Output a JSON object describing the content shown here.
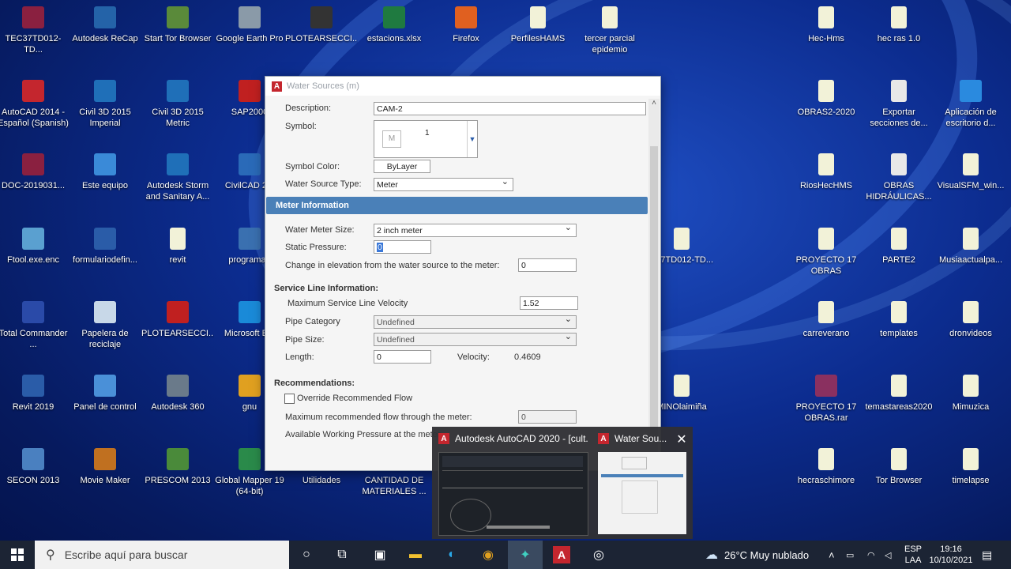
{
  "desktop_icons": [
    {
      "label": "TEC37TD012-TD...",
      "icon": "bitmap-icon",
      "color": "#8a2040"
    },
    {
      "label": "Autodesk ReCap",
      "icon": "recap-icon",
      "color": "#2463a8"
    },
    {
      "label": "Start Tor Browser",
      "icon": "tor-icon",
      "color": "#5a8a3a"
    },
    {
      "label": "Google Earth Pro",
      "icon": "earth-icon",
      "color": "#8a9aa8"
    },
    {
      "label": "PLOTEARSECCI...",
      "icon": "printer-icon",
      "color": "#333333"
    },
    {
      "label": "estacions.xlsx",
      "icon": "excel-icon",
      "color": "#1f7a40"
    },
    {
      "label": "Firefox",
      "icon": "firefox-icon",
      "color": "#e06020"
    },
    {
      "label": "PerfilesHAMS",
      "icon": "file-icon",
      "color": "#f2f2d8"
    },
    {
      "label": "tercer parcial epidemio",
      "icon": "pdf-file-icon",
      "color": "#f2f2d8"
    },
    {
      "label": "Hec-Hms",
      "icon": "file-icon",
      "color": "#f2f2d8"
    },
    {
      "label": "hec ras 1.0",
      "icon": "folder-file-icon",
      "color": "#f2f2d8"
    },
    {
      "label": "AutoCAD 2014 - Español (Spanish)",
      "icon": "autocad-icon",
      "color": "#c4262e"
    },
    {
      "label": "Civil 3D 2015 Imperial",
      "icon": "civil3d-icon",
      "color": "#1f6fb8"
    },
    {
      "label": "Civil 3D 2015 Metric",
      "icon": "civil3d-icon",
      "color": "#1f6fb8"
    },
    {
      "label": "SAP2000",
      "icon": "sap-icon",
      "color": "#c02020"
    },
    {
      "label": "OBRAS2-2020",
      "icon": "file-icon",
      "color": "#f2f2d8"
    },
    {
      "label": "Exportar secciones de...",
      "icon": "document-icon",
      "color": "#e8e8e8"
    },
    {
      "label": "Aplicación de escritorio d...",
      "icon": "app-icon",
      "color": "#2a8adf"
    },
    {
      "label": "DOC-2019031...",
      "icon": "bitmap-icon",
      "color": "#8a2040"
    },
    {
      "label": "Este equipo",
      "icon": "computer-icon",
      "color": "#3a8ad8"
    },
    {
      "label": "Autodesk Storm and Sanitary A...",
      "icon": "storm-icon",
      "color": "#1f6fb8"
    },
    {
      "label": "CivilCAD 2...",
      "icon": "civilcad-icon",
      "color": "#2a6ab8"
    },
    {
      "label": "RiosHecHMS",
      "icon": "file-icon",
      "color": "#f2f2d8"
    },
    {
      "label": "OBRAS HIDRÁULICAS...",
      "icon": "document-icon",
      "color": "#e8e8e8"
    },
    {
      "label": "VisualSFM_win...",
      "icon": "file-icon",
      "color": "#f2f2d8"
    },
    {
      "label": "Ftool.exe.enc",
      "icon": "ftool-icon",
      "color": "#5aa0d0"
    },
    {
      "label": "formulariodefin...",
      "icon": "word-icon",
      "color": "#2a5ca8"
    },
    {
      "label": "revit",
      "icon": "file-icon",
      "color": "#f2f2d8"
    },
    {
      "label": "programa1",
      "icon": "python-icon",
      "color": "#3a70b0"
    },
    {
      "label": "E37TD012-TD...",
      "icon": "file-icon",
      "color": "#f2f2d8"
    },
    {
      "label": "PROYECTO 17 OBRAS",
      "icon": "pdf-file-icon",
      "color": "#f2f2d8"
    },
    {
      "label": "PARTE2",
      "icon": "file-icon",
      "color": "#f2f2d8"
    },
    {
      "label": "Musiaactualpa...",
      "icon": "file-icon",
      "color": "#f2f2d8"
    },
    {
      "label": "Total Commander ...",
      "icon": "floppy-icon",
      "color": "#2a4aa8"
    },
    {
      "label": "Papelera de reciclaje",
      "icon": "recycle-bin-icon",
      "color": "#c8d8e8"
    },
    {
      "label": "PLOTEARSECCI...",
      "icon": "pdf-icon",
      "color": "#c02020"
    },
    {
      "label": "Microsoft E...",
      "icon": "edge-icon",
      "color": "#1a8ad8"
    },
    {
      "label": "carreverano",
      "icon": "file-icon",
      "color": "#f2f2d8"
    },
    {
      "label": "templates",
      "icon": "folder-file-icon",
      "color": "#f2f2d8"
    },
    {
      "label": "dronvideos",
      "icon": "file-icon",
      "color": "#f2f2d8"
    },
    {
      "label": "Revit 2019",
      "icon": "revit-icon",
      "color": "#2a5ca8"
    },
    {
      "label": "Panel de control",
      "icon": "control-panel-icon",
      "color": "#4a90d8"
    },
    {
      "label": "Autodesk 360",
      "icon": "cloud-icon",
      "color": "#6a7a8a"
    },
    {
      "label": "gnu",
      "icon": "chrome-icon",
      "color": "#e0a020"
    },
    {
      "label": "MINOlaimiña",
      "icon": "file-icon",
      "color": "#f2f2d8"
    },
    {
      "label": "PROYECTO 17 OBRAS.rar",
      "icon": "winrar-icon",
      "color": "#8a3060"
    },
    {
      "label": "temastareas2020",
      "icon": "file-icon",
      "color": "#f2f2d8"
    },
    {
      "label": "Mimuzica",
      "icon": "file-icon",
      "color": "#f2f2d8"
    },
    {
      "label": "SECON 2013",
      "icon": "gear-icon",
      "color": "#4a80c0"
    },
    {
      "label": "Movie Maker",
      "icon": "movie-maker-icon",
      "color": "#c07020"
    },
    {
      "label": "PRESCOM 2013",
      "icon": "calculator-icon",
      "color": "#4a8a3a"
    },
    {
      "label": "Global Mapper 19 (64-bit)",
      "icon": "globe-icon",
      "color": "#2a8a4a"
    },
    {
      "label": "Utilidades",
      "icon": "none",
      "color": "transparent"
    },
    {
      "label": "CANTIDAD DE MATERIALES ...",
      "icon": "none",
      "color": "transparent"
    },
    {
      "label": "hecraschimore",
      "icon": "file-icon",
      "color": "#f2f2d8"
    },
    {
      "label": "Tor Browser",
      "icon": "file-icon",
      "color": "#f2f2d8"
    },
    {
      "label": "timelapse",
      "icon": "pdf-file-icon",
      "color": "#f2f2d8"
    }
  ],
  "dialog": {
    "title": "Water Sources (m)",
    "description_label": "Description:",
    "description_value": "CAM-2",
    "symbol_label": "Symbol:",
    "symbol_value": "1",
    "symbol_glyph": "M",
    "symbol_color_label": "Symbol Color:",
    "symbol_color_value": "ByLayer",
    "source_type_label": "Water Source Type:",
    "source_type_value": "Meter",
    "meter_section": "Meter Information",
    "meter_size_label": "Water Meter Size:",
    "meter_size_value": "2 inch meter",
    "static_pressure_label": "Static Pressure:",
    "static_pressure_value": "0",
    "elev_change_label": "Change in elevation from the water source to the meter:",
    "elev_change_value": "0",
    "service_line_heading": "Service Line Information:",
    "max_velocity_label": "Maximum Service Line Velocity",
    "max_velocity_value": "1.52",
    "pipe_category_label": "Pipe Category",
    "pipe_category_value": "Undefined",
    "pipe_size_label": "Pipe Size:",
    "pipe_size_value": "Undefined",
    "length_label": "Length:",
    "length_value": "0",
    "velocity_label": "Velocity:",
    "velocity_value": "0.4609",
    "recommendations_heading": "Recommendations:",
    "override_label": "Override Recommended Flow",
    "max_flow_label": "Maximum recommended flow through the meter:",
    "max_flow_value": "0",
    "available_pressure_label": "Available Working Pressure at the meter"
  },
  "preview": {
    "window1_title": "Autodesk AutoCAD 2020 - [cult...",
    "window2_title": "Water Sou...",
    "close_glyph": "✕"
  },
  "taskbar": {
    "search_placeholder": "Escribe aquí para buscar",
    "weather": "26°C  Muy nublado",
    "language_line1": "ESP",
    "language_line2": "LAA",
    "time": "19:16",
    "date": "10/10/2021"
  }
}
